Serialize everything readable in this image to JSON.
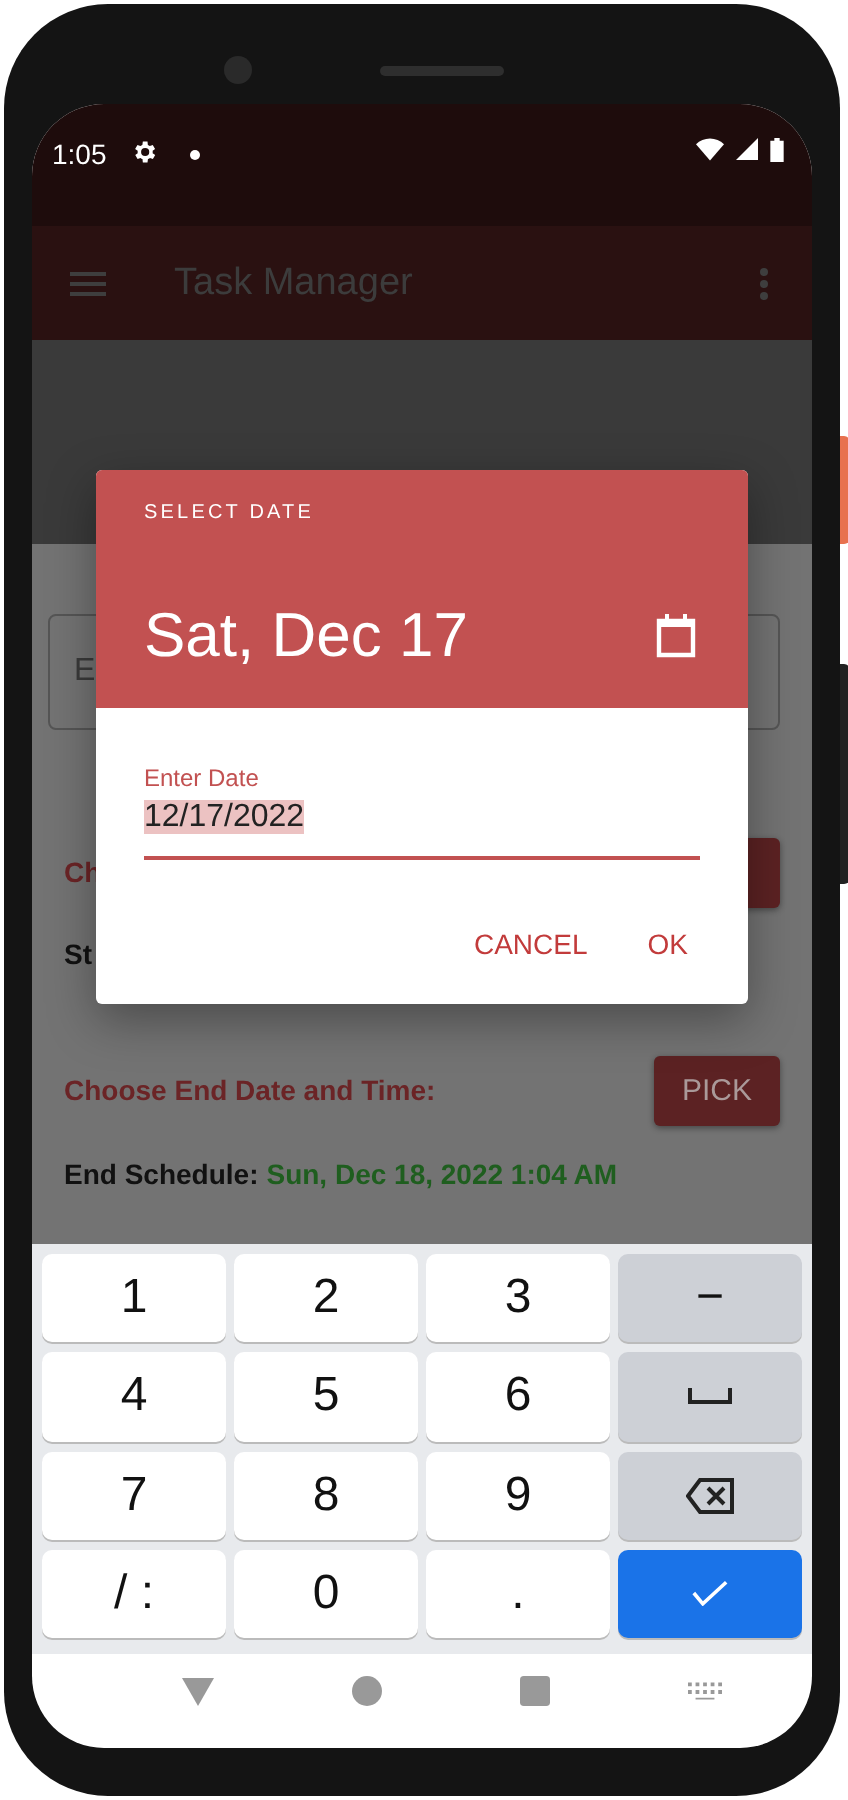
{
  "status_bar": {
    "time": "1:05"
  },
  "app_bar": {
    "title": "Task Manager"
  },
  "form": {
    "field_label": "E",
    "start_label": "Ch",
    "start_schedule_label": "St",
    "end_label": "Choose End Date and Time:",
    "end_button": "PICK",
    "end_schedule_label": "End Schedule:",
    "end_schedule_value": "Sun, Dec 18, 2022 1:04 AM"
  },
  "dialog": {
    "overline": "SELECT DATE",
    "headline": "Sat, Dec 17",
    "field_label": "Enter Date",
    "value": "12/17/2022",
    "buttons": [
      "CANCEL",
      "OK"
    ]
  },
  "keyboard": {
    "keys": [
      {
        "kind": "char",
        "label": "1"
      },
      {
        "kind": "char",
        "label": "2"
      },
      {
        "kind": "char",
        "label": "3"
      },
      {
        "kind": "function",
        "label": "−"
      },
      {
        "kind": "char",
        "label": "4"
      },
      {
        "kind": "char",
        "label": "5"
      },
      {
        "kind": "char",
        "label": "6"
      },
      {
        "kind": "space"
      },
      {
        "kind": "char",
        "label": "7"
      },
      {
        "kind": "char",
        "label": "8"
      },
      {
        "kind": "char",
        "label": "9"
      },
      {
        "kind": "backspace"
      },
      {
        "kind": "char",
        "label": "/ :"
      },
      {
        "kind": "char",
        "label": "0"
      },
      {
        "kind": "char",
        "label": "."
      },
      {
        "kind": "enter"
      }
    ]
  }
}
